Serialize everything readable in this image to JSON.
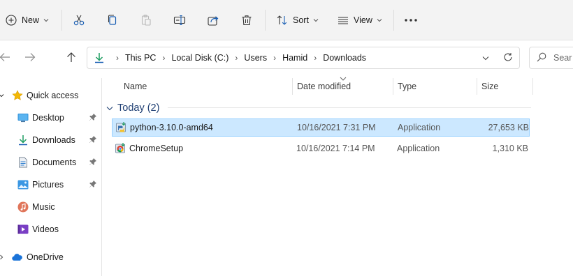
{
  "toolbar": {
    "new_label": "New",
    "sort_label": "Sort",
    "view_label": "View",
    "icons": [
      "new-icon",
      "cut-icon",
      "copy-icon",
      "paste-icon",
      "rename-icon",
      "share-icon",
      "delete-icon",
      "sort-icon",
      "view-icon",
      "more-icon"
    ]
  },
  "address": {
    "breadcrumbs": [
      "This PC",
      "Local Disk (C:)",
      "Users",
      "Hamid",
      "Downloads"
    ],
    "search_placeholder": "Sear"
  },
  "sidebar": {
    "quick_access": "Quick access",
    "items": [
      {
        "label": "Desktop",
        "icon": "desktop-icon",
        "pinned": true
      },
      {
        "label": "Downloads",
        "icon": "downloads-icon",
        "pinned": true
      },
      {
        "label": "Documents",
        "icon": "documents-icon",
        "pinned": true
      },
      {
        "label": "Pictures",
        "icon": "pictures-icon",
        "pinned": true
      },
      {
        "label": "Music",
        "icon": "music-icon",
        "pinned": false
      },
      {
        "label": "Videos",
        "icon": "videos-icon",
        "pinned": false
      }
    ],
    "onedrive": "OneDrive"
  },
  "columns": {
    "name": "Name",
    "date": "Date modified",
    "type": "Type",
    "size": "Size"
  },
  "group": {
    "title": "Today (2)"
  },
  "files": [
    {
      "name": "python-3.10.0-amd64",
      "date": "10/16/2021 7:31 PM",
      "type": "Application",
      "size": "27,653 KB",
      "selected": true
    },
    {
      "name": "ChromeSetup",
      "date": "10/16/2021 7:14 PM",
      "type": "Application",
      "size": "1,310 KB",
      "selected": false
    }
  ],
  "colors": {
    "selection": "#cce8ff",
    "accent_blue": "#0067c0",
    "download_green": "#1f9e62",
    "star_yellow": "#f2b705"
  }
}
